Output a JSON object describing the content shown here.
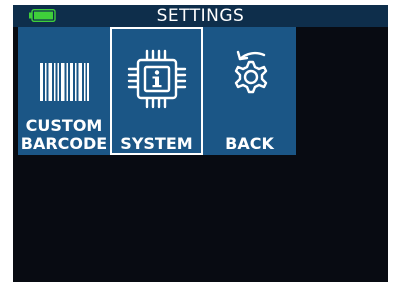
{
  "header": {
    "title": "SETTINGS",
    "battery_icon": "battery-full-icon",
    "battery_color": "#3fcf3a"
  },
  "tiles": [
    {
      "label_line1": "CUSTOM",
      "label_line2": "BARCODE",
      "icon": "barcode-icon"
    },
    {
      "label": "SYSTEM",
      "icon": "chip-info-icon",
      "selected": true
    },
    {
      "label": "BACK",
      "icon": "gear-back-arrow-icon"
    }
  ],
  "colors": {
    "header_bg": "#0e2e4b",
    "tile_bg": "#1b5686",
    "screen_bg": "#080b12"
  }
}
